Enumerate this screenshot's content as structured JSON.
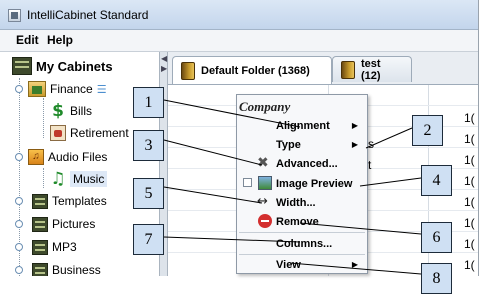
{
  "window": {
    "title": "IntelliCabinet Standard"
  },
  "menubar": {
    "edit": "Edit",
    "help": "Help"
  },
  "tree": {
    "root": "My Cabinets",
    "finance": "Finance",
    "bills": "Bills",
    "retirement": "Retirement",
    "audio": "Audio Files",
    "music": "Music",
    "templates": "Templates",
    "pictures": "Pictures",
    "mp3": "MP3",
    "business": "Business"
  },
  "tabs": [
    {
      "label": "Default Folder (1368)"
    },
    {
      "label": "test (12)"
    }
  ],
  "table": {
    "col1_fragments": [
      "s",
      "t"
    ],
    "right_col": [
      "1(",
      "1(",
      "1(",
      "1(",
      "1(",
      "1(",
      "1(",
      "1(",
      "1("
    ]
  },
  "context_menu": {
    "header": "Company",
    "alignment": "Alignment",
    "type": "Type",
    "advanced": "Advanced...",
    "image_preview": "Image Preview",
    "width": "Width...",
    "remove": "Remove",
    "columns": "Columns...",
    "view": "View"
  },
  "callouts": [
    "1",
    "2",
    "3",
    "4",
    "5",
    "6",
    "7",
    "8"
  ],
  "colors": {
    "callout_fill": "#cfe0f3",
    "remove_red": "#d32f2f",
    "selection": "#dde8f6"
  },
  "icons": {
    "cabinet": "cabinet-icon",
    "folder": "folder-icon",
    "advanced": "tools-icon",
    "image_preview": "image-icon",
    "width": "resize-horizontal-icon",
    "remove": "no-entry-icon"
  }
}
